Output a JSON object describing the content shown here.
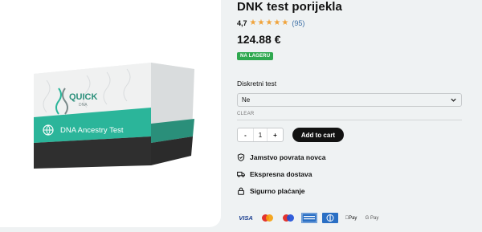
{
  "product": {
    "box_brand": "QUICK",
    "box_brand_sub": "DNA",
    "box_label": "DNA Ancestry Test"
  },
  "info": {
    "title": "DNK test porijekla",
    "rating_value": "4,7",
    "rating_stars": 4.7,
    "review_count": "(95)",
    "price": "124.88 €",
    "stock_badge": "NA LAGERU",
    "variant_label": "Diskretni test",
    "variant_selected": "Ne",
    "clear_label": "CLEAR",
    "quantity": "1",
    "qty_minus": "-",
    "qty_plus": "+",
    "add_to_cart": "Add to cart"
  },
  "features": [
    {
      "icon": "shield-check-icon",
      "label": "Jamstvo povrata novca"
    },
    {
      "icon": "truck-icon",
      "label": "Ekspresna dostava"
    },
    {
      "icon": "lock-icon",
      "label": "Sigurno plaćanje"
    }
  ],
  "payments": {
    "visa": "VISA",
    "maestro": "maestro",
    "mastercard": "mastercard",
    "amex": "american-express-icon",
    "diners": "diners-club-icon",
    "apple_pay": "Pay",
    "google_pay": "G Pay"
  },
  "colors": {
    "accent_teal": "#2bb59a",
    "badge_green": "#2fa84f",
    "star": "#f0a33b",
    "button_dark": "#121212"
  }
}
